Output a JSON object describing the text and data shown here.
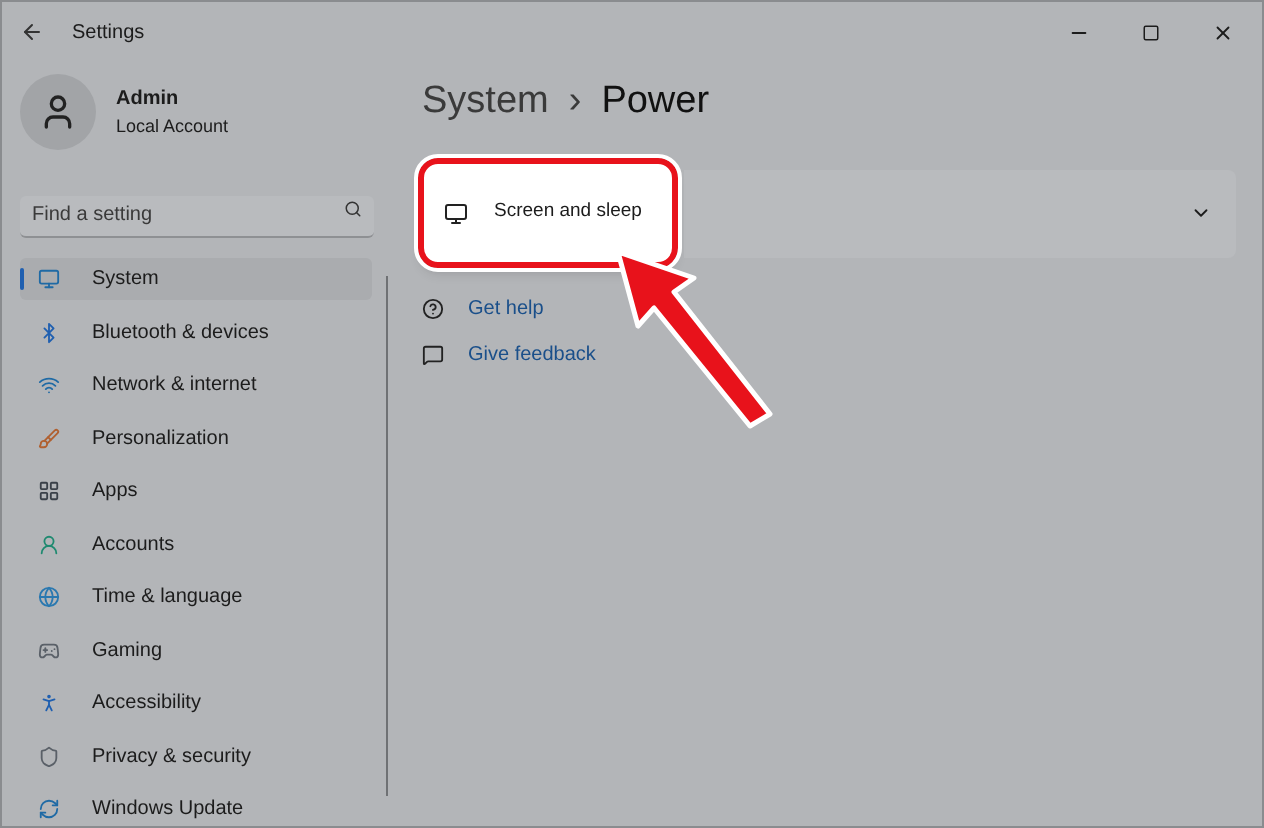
{
  "window": {
    "title": "Settings"
  },
  "profile": {
    "name": "Admin",
    "account": "Local Account"
  },
  "search": {
    "placeholder": "Find a setting"
  },
  "sidebar": {
    "items": [
      {
        "label": "System",
        "selected": true
      },
      {
        "label": "Bluetooth & devices",
        "selected": false
      },
      {
        "label": "Network & internet",
        "selected": false
      },
      {
        "label": "Personalization",
        "selected": false
      },
      {
        "label": "Apps",
        "selected": false
      },
      {
        "label": "Accounts",
        "selected": false
      },
      {
        "label": "Time & language",
        "selected": false
      },
      {
        "label": "Gaming",
        "selected": false
      },
      {
        "label": "Accessibility",
        "selected": false
      },
      {
        "label": "Privacy & security",
        "selected": false
      },
      {
        "label": "Windows Update",
        "selected": false
      }
    ]
  },
  "breadcrumb": {
    "parent": "System",
    "separator": "›",
    "current": "Power"
  },
  "card": {
    "label": "Screen and sleep",
    "expanded": false,
    "highlighted": true
  },
  "links": [
    "Get help",
    "Give feedback"
  ]
}
